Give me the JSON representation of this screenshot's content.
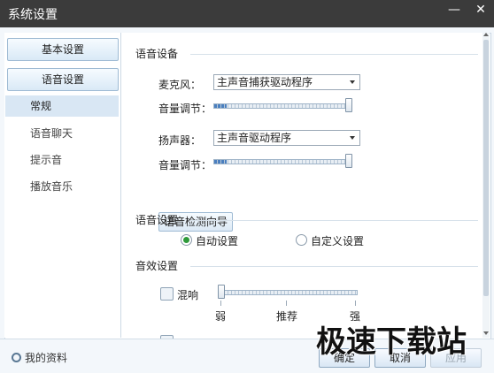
{
  "window": {
    "title": "系统设置",
    "min_glyph": "—",
    "close_glyph": "✕"
  },
  "sidebar": {
    "basic_settings": "基本设置",
    "voice_settings": "语音设置",
    "items": [
      {
        "label": "常规",
        "active": true
      },
      {
        "label": "语音聊天"
      },
      {
        "label": "提示音"
      },
      {
        "label": "播放音乐"
      }
    ]
  },
  "voice_device": {
    "section_title": "语音设备",
    "mic_label": "麦克风：",
    "mic_value": "主声音捕获驱动程序",
    "mic_volume_label": "音量调节：",
    "mic_volume_level": 1.0,
    "speaker_label": "扬声器：",
    "speaker_value": "主声音驱动程序",
    "speaker_volume_label": "音量调节：",
    "speaker_volume_level": 1.0,
    "wizard_button": "语音检测向导"
  },
  "voice_settings": {
    "section_title": "语音设置",
    "auto_label": "自动设置",
    "custom_label": "自定义设置",
    "selected": "auto"
  },
  "sound_effects": {
    "section_title": "音效设置",
    "reverb_label": "混响",
    "reverb_checked": false,
    "scale_weak": "弱",
    "scale_mid": "推荐",
    "scale_strong": "强"
  },
  "footer": {
    "profile_label": "我的资料",
    "ok_button": "确定",
    "cancel_button": "取消",
    "apply_button": "应用"
  },
  "watermark": {
    "text": "极速下载站"
  },
  "colors": {
    "titlebar": "#3b3b3b",
    "slider_fill": "#4a7fbf",
    "radio_on": "#2e9a3a"
  }
}
